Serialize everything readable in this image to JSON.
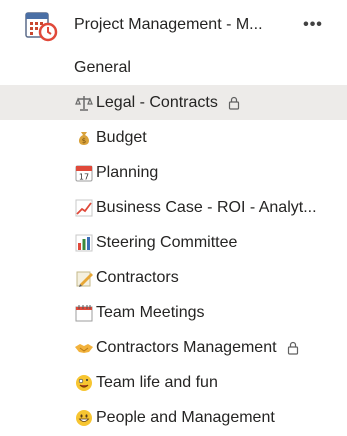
{
  "team": {
    "name": "Project Management - M...",
    "more_label": "•••",
    "icon": "calendar-clock-icon"
  },
  "channels": [
    {
      "label": "General",
      "icon": "",
      "selected": false,
      "private": false
    },
    {
      "label": "Legal - Contracts",
      "icon": "balance-scale-icon",
      "selected": true,
      "private": true
    },
    {
      "label": "Budget",
      "icon": "money-bag-icon",
      "selected": false,
      "private": false
    },
    {
      "label": "Planning",
      "icon": "calendar-17-icon",
      "selected": false,
      "private": false
    },
    {
      "label": "Business Case - ROI - Analyt...",
      "icon": "chart-increasing-icon",
      "selected": false,
      "private": false
    },
    {
      "label": "Steering Committee",
      "icon": "bar-chart-icon",
      "selected": false,
      "private": false
    },
    {
      "label": "Contractors",
      "icon": "memo-pencil-icon",
      "selected": false,
      "private": false
    },
    {
      "label": "Team Meetings",
      "icon": "spiral-calendar-icon",
      "selected": false,
      "private": false
    },
    {
      "label": "Contractors Management",
      "icon": "handshake-icon",
      "selected": false,
      "private": true
    },
    {
      "label": "Team life and fun",
      "icon": "zany-face-icon",
      "selected": false,
      "private": false
    },
    {
      "label": "People and Management",
      "icon": "grinning-face-icon",
      "selected": false,
      "private": false
    }
  ],
  "colors": {
    "selected_bg": "#edebe9",
    "text": "#252423"
  }
}
